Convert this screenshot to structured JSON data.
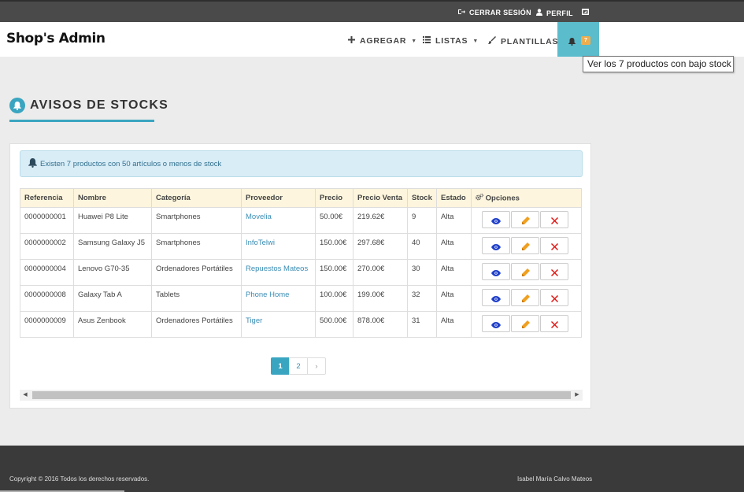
{
  "topbar": {
    "logout_label": "CERRAR SESIÓN",
    "profile_label": "PERFIL"
  },
  "navbar": {
    "brand": "Shop's Admin",
    "add_label": "AGREGAR",
    "lists_label": "LISTAS",
    "templates_label": "PLANTILLAS",
    "alert_count": "7"
  },
  "tooltip": "Ver los 7 productos con bajo stock",
  "page": {
    "title": "AVISOS DE STOCKS",
    "alert_text": "Existen 7 productos con 50 artículos o menos de stock"
  },
  "table": {
    "headers": [
      "Referencia",
      "Nombre",
      "Categoría",
      "Proveedor",
      "Precio",
      "Precio Venta",
      "Stock",
      "Estado",
      "Opciones"
    ],
    "rows": [
      [
        "0000000001",
        "Huawei P8 Lite",
        "Smartphones",
        "Movelia",
        "50.00€",
        "219.62€",
        "9",
        "Alta"
      ],
      [
        "0000000002",
        "Samsung Galaxy J5",
        "Smartphones",
        "InfoTelwi",
        "150.00€",
        "297.68€",
        "40",
        "Alta"
      ],
      [
        "0000000004",
        "Lenovo G70-35",
        "Ordenadores Portátiles",
        "Repuestos Mateos",
        "150.00€",
        "270.00€",
        "30",
        "Alta"
      ],
      [
        "0000000008",
        "Galaxy Tab A",
        "Tablets",
        "Phone Home",
        "100.00€",
        "199.00€",
        "32",
        "Alta"
      ],
      [
        "0000000009",
        "Asus Zenbook",
        "Ordenadores Portátiles",
        "Tiger",
        "500.00€",
        "878.00€",
        "31",
        "Alta"
      ]
    ]
  },
  "pagination": {
    "pages": [
      "1",
      "2"
    ],
    "next": "›",
    "current": "1"
  },
  "footer": {
    "copyright": "Copyright © 2016 Todos los derechos reservados.",
    "author": "Isabel María Calvo Mateos"
  },
  "colors": {
    "accent": "#3aa5c0",
    "badge": "#f0ad4e",
    "topbar": "#4a4a4a",
    "footer": "#3a3a3a"
  },
  "icons": {
    "logout": "sign-out-icon",
    "profile": "user-icon",
    "window": "window-icon",
    "add": "plus-icon",
    "lists": "list-icon",
    "templates": "brush-icon",
    "bell": "bell-icon",
    "options": "gears-icon",
    "view": "eye-icon",
    "edit": "pencil-icon",
    "delete": "times-icon"
  }
}
